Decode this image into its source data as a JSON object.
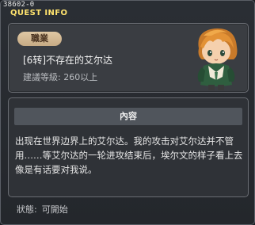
{
  "window": {
    "id": "38602-0",
    "title": "QUEST INFO"
  },
  "info": {
    "job_tag": "職業",
    "quest_name": "[6转]不存在的艾尔达",
    "required_level": "建議等級: 260以上"
  },
  "content": {
    "header": "內容",
    "body": "出现在世界边界上的艾尔达。我的攻击对艾尔达并不管用……等艾尔达的一轮进攻结束后，埃尔文的样子看上去像是有话要对我说。"
  },
  "status": {
    "label": "狀態:",
    "value": "可開始"
  },
  "icons": {
    "portrait": "npc-portrait-icon"
  },
  "colors": {
    "title": "#ffe36e",
    "job_tag_bg": "#d6bd97",
    "panel_bg": "#3a3d42",
    "content_header_bg": "#50555c"
  }
}
